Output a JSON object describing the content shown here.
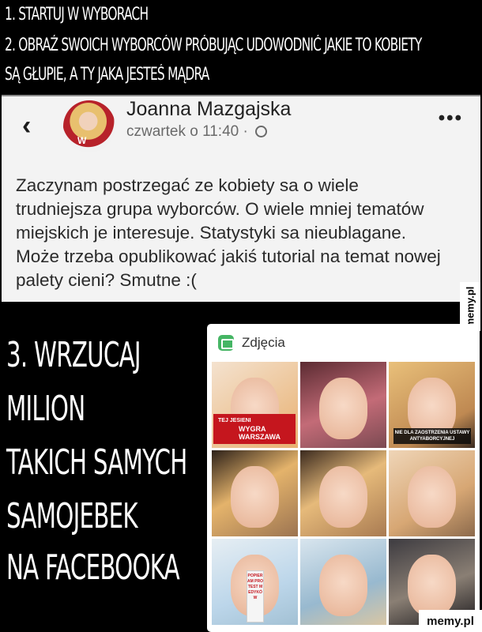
{
  "caption_top": {
    "line1": "1. STARTUJ  W WYBORACH",
    "line2a": "2. OBRAŹ SWOICH WYBORCÓW PRÓBUJĄC UDOWODNIĆ JAKIE TO KOBIETY",
    "line2b": "SĄ GŁUPIE, A TY JAKA JESTEŚ MĄDRA"
  },
  "post": {
    "author": "Joanna Mazgajska",
    "timestamp": "czwartek o 11:40 ·",
    "text": "Zaczynam postrzegać ze kobiety sa o wiele\ntrudniejsza grupa wyborców. O wiele mniej tematów\nmiejskich je interesuje. Statystyki sa nieublagane.\nMoże trzeba opublikować jakiś tutorial na temat nowej\npalety cieni? Smutne :(",
    "back_glyph": "‹",
    "more_glyph": "•••",
    "avatar_mark": "W"
  },
  "caption_big": {
    "line1": "3. WRZUCAJ",
    "line2": "MILION",
    "line3": "TAKICH SAMYCH",
    "line4": "SAMOJEBEK",
    "line5": "NA FACEBOOKA"
  },
  "photos": {
    "title": "Zdjęcia",
    "badge_red_top": "TEJ JESIENI",
    "badge_red_main": "WYGRA WARSZAWA",
    "badge_dark": "NIE DLA ZAOSTRZENIA USTAWY ANTYABORCYJNEJ",
    "badge_vertical": "POPIERAM PROTEST MEDYKÓW"
  },
  "watermark": {
    "side": "memy.pl",
    "bottom": "memy.pl"
  }
}
